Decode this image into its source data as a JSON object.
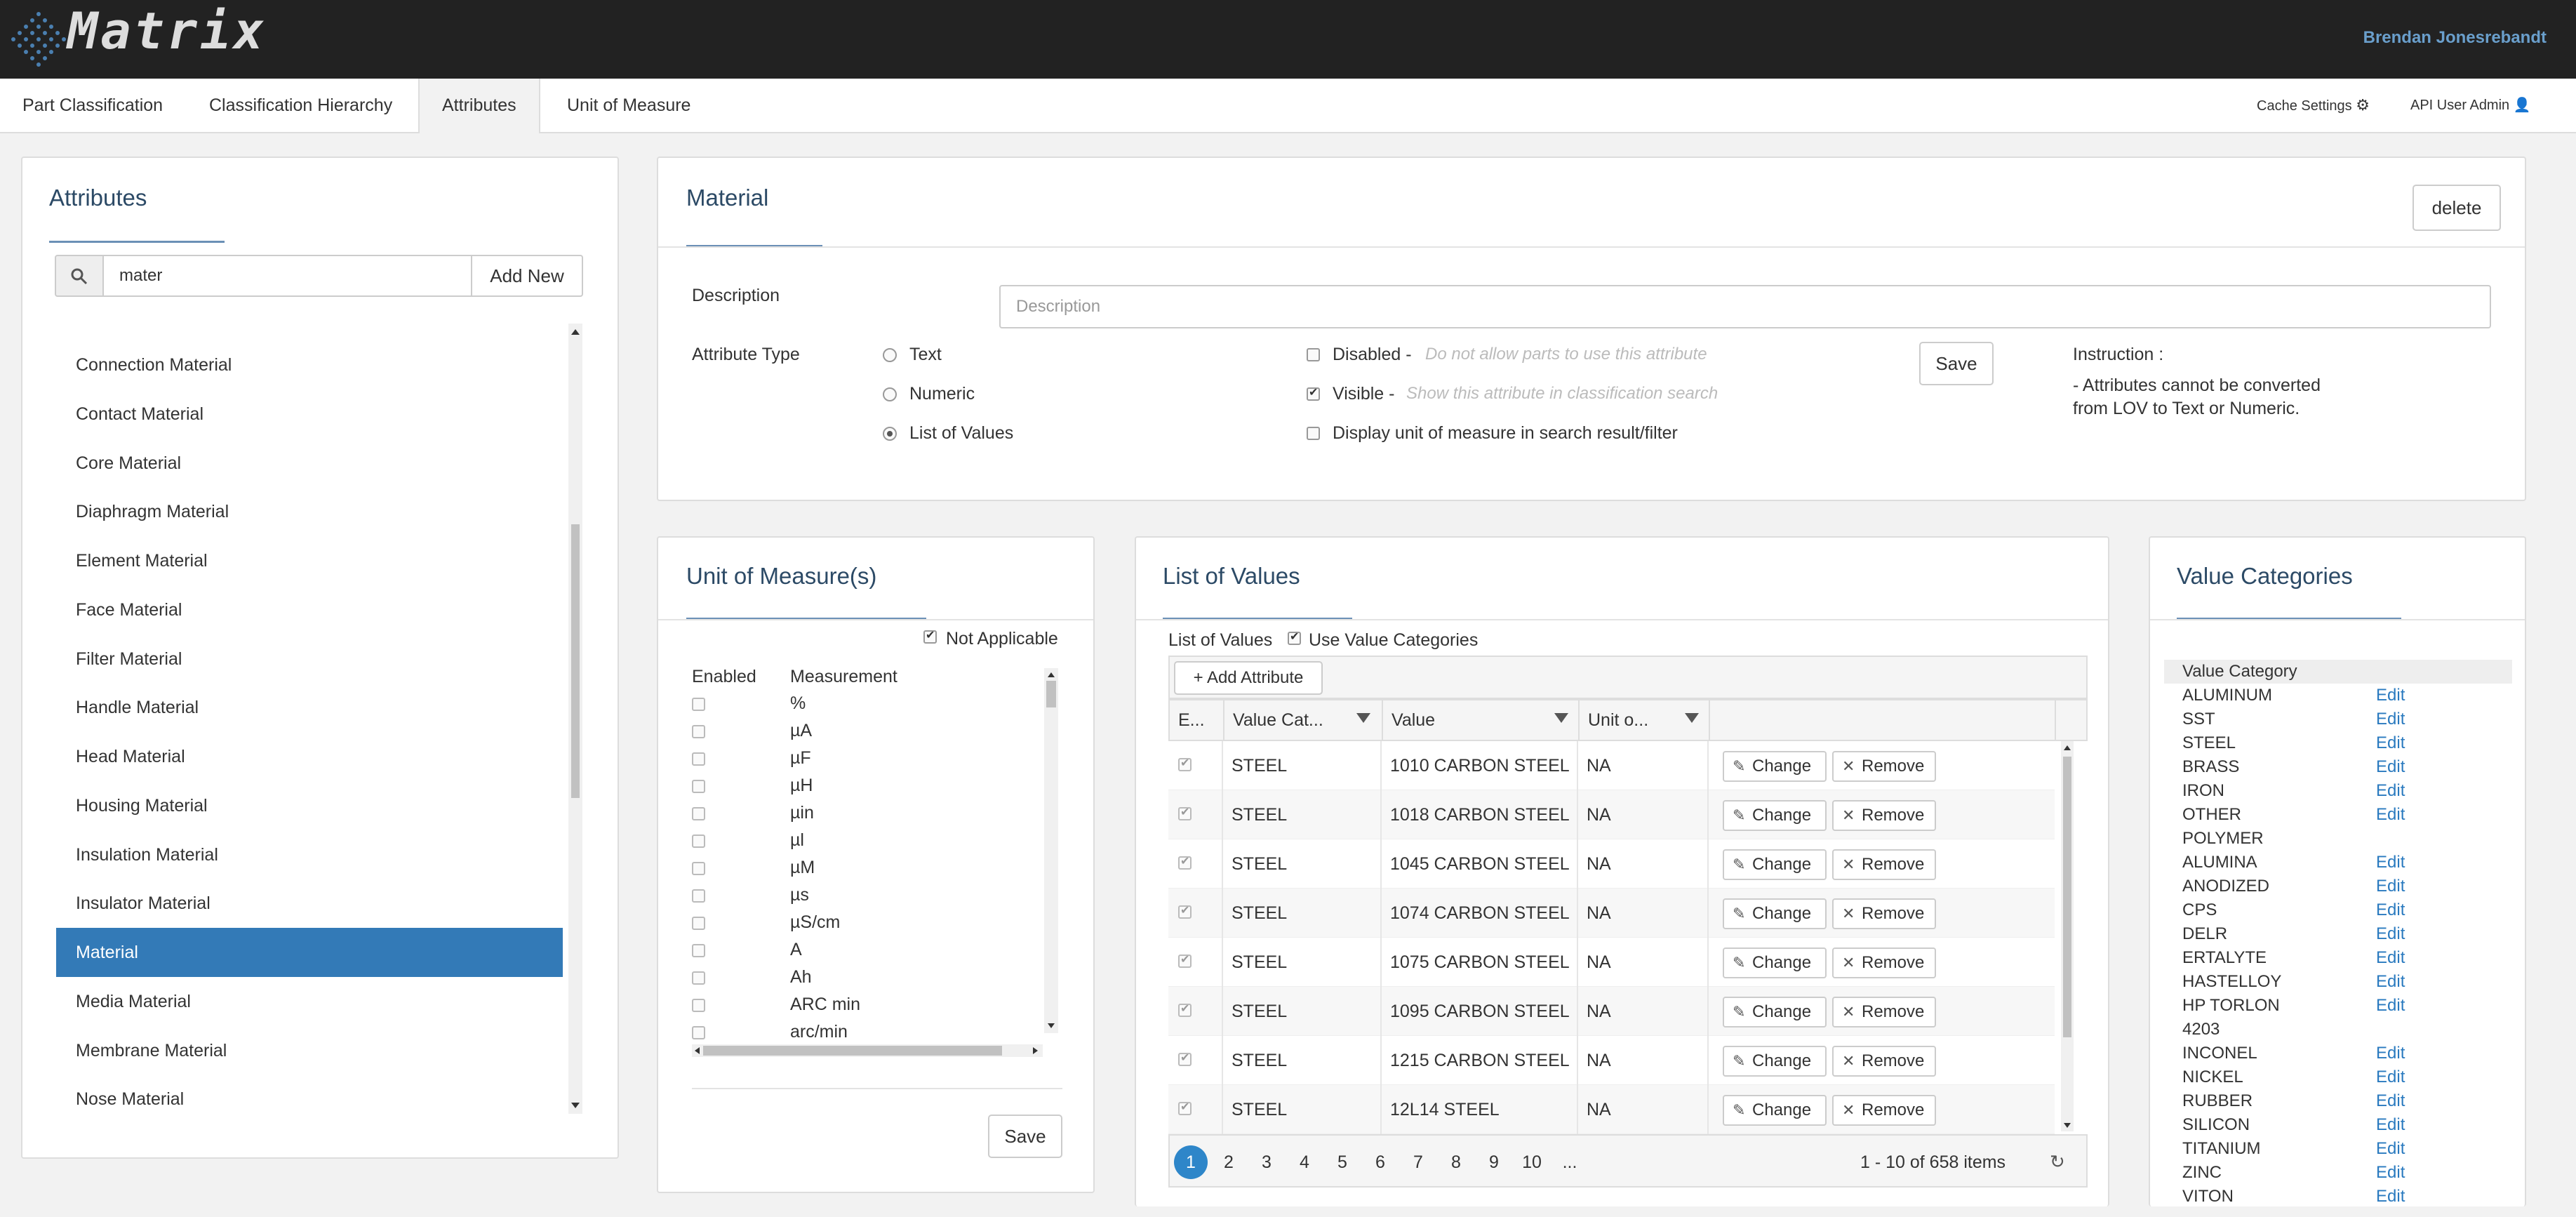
{
  "app": {
    "name": "Matrix",
    "user": "Brendan Jonesrebandt"
  },
  "nav": {
    "tabs": [
      {
        "label": "Part Classification"
      },
      {
        "label": "Classification Hierarchy"
      },
      {
        "label": "Attributes"
      },
      {
        "label": "Unit of Measure"
      }
    ],
    "active_tab": "Attributes",
    "cache_settings": "Cache Settings",
    "api_user_admin": "API User Admin"
  },
  "attributes_panel": {
    "title": "Attributes",
    "search_value": "mater",
    "add_new_label": "Add New",
    "items": [
      "Connection Material",
      "Contact Material",
      "Core Material",
      "Diaphragm Material",
      "Element Material",
      "Face Material",
      "Filter Material",
      "Handle Material",
      "Head Material",
      "Housing Material",
      "Insulation Material",
      "Insulator Material",
      "Material",
      "Media Material",
      "Membrane Material",
      "Nose Material"
    ],
    "selected": "Material"
  },
  "detail": {
    "title": "Material",
    "delete_label": "delete",
    "description_label": "Description",
    "description_placeholder": "Description",
    "description_value": "",
    "attribute_type_label": "Attribute Type",
    "types": [
      {
        "label": "Text",
        "selected": false
      },
      {
        "label": "Numeric",
        "selected": false
      },
      {
        "label": "List of Values",
        "selected": true
      }
    ],
    "flags": [
      {
        "label": "Disabled",
        "hint": "Do not allow parts to use this attribute",
        "checked": false
      },
      {
        "label": "Visible",
        "hint": "Show this attribute in classification search",
        "checked": true
      },
      {
        "label": "Display unit of measure in search result/filter",
        "hint": "",
        "checked": false
      }
    ],
    "save_label": "Save",
    "instruction_title": "Instruction :",
    "instruction_line1": "- Attributes cannot be converted",
    "instruction_line2": "from LOV to Text or Numeric."
  },
  "uom": {
    "title": "Unit of Measure(s)",
    "not_applicable_label": "Not Applicable",
    "not_applicable_checked": true,
    "col_enabled": "Enabled",
    "col_measurement": "Measurement",
    "rows": [
      "%",
      "µA",
      "µF",
      "µH",
      "µin",
      "µl",
      "µM",
      "µs",
      "µS/cm",
      "A",
      "Ah",
      "ARC min",
      "arc/min"
    ],
    "save_label": "Save"
  },
  "lov": {
    "title": "List of Values",
    "list_label": "List of Values",
    "use_categories_label": "Use Value Categories",
    "use_categories_checked": true,
    "add_attribute_label": "Add Attribute",
    "columns": [
      "E...",
      "Value Cat...",
      "Value",
      "Unit o..."
    ],
    "rows": [
      {
        "category": "STEEL",
        "value": "1010 CARBON STEEL",
        "unit": "NA"
      },
      {
        "category": "STEEL",
        "value": "1018 CARBON STEEL",
        "unit": "NA"
      },
      {
        "category": "STEEL",
        "value": "1045 CARBON STEEL",
        "unit": "NA"
      },
      {
        "category": "STEEL",
        "value": "1074 CARBON STEEL",
        "unit": "NA"
      },
      {
        "category": "STEEL",
        "value": "1075 CARBON STEEL",
        "unit": "NA"
      },
      {
        "category": "STEEL",
        "value": "1095 CARBON STEEL",
        "unit": "NA"
      },
      {
        "category": "STEEL",
        "value": "1215 CARBON STEEL",
        "unit": "NA"
      },
      {
        "category": "STEEL",
        "value": "12L14 STEEL",
        "unit": "NA"
      }
    ],
    "change_label": "Change",
    "remove_label": "Remove",
    "pages": [
      "1",
      "2",
      "3",
      "4",
      "5",
      "6",
      "7",
      "8",
      "9",
      "10",
      "..."
    ],
    "current_page": "1",
    "summary": "1 - 10 of 658 items"
  },
  "value_categories": {
    "title": "Value Categories",
    "header": "Value Category",
    "edit_label": "Edit",
    "items": [
      {
        "name": "ALUMINUM",
        "edit": true
      },
      {
        "name": "SST",
        "edit": true
      },
      {
        "name": "STEEL",
        "edit": true
      },
      {
        "name": "BRASS",
        "edit": true
      },
      {
        "name": "IRON",
        "edit": true
      },
      {
        "name": "OTHER",
        "edit": true
      },
      {
        "name": "POLYMER",
        "edit": false
      },
      {
        "name": "ALUMINA",
        "edit": true
      },
      {
        "name": "ANODIZED",
        "edit": true
      },
      {
        "name": "CPS",
        "edit": true
      },
      {
        "name": "DELR",
        "edit": true
      },
      {
        "name": "ERTALYTE",
        "edit": true
      },
      {
        "name": "HASTELLOY",
        "edit": true
      },
      {
        "name": "HP TORLON",
        "edit": true
      },
      {
        "name": "4203",
        "edit": false
      },
      {
        "name": "INCONEL",
        "edit": true
      },
      {
        "name": "NICKEL",
        "edit": true
      },
      {
        "name": "RUBBER",
        "edit": true
      },
      {
        "name": "SILICON",
        "edit": true
      },
      {
        "name": "TITANIUM",
        "edit": true
      },
      {
        "name": "ZINC",
        "edit": true
      },
      {
        "name": "VITON",
        "edit": true
      }
    ]
  },
  "colors": {
    "topbar": "#222222",
    "selected": "#337ab7",
    "link": "#2a7abf",
    "title": "#2c4a66"
  }
}
